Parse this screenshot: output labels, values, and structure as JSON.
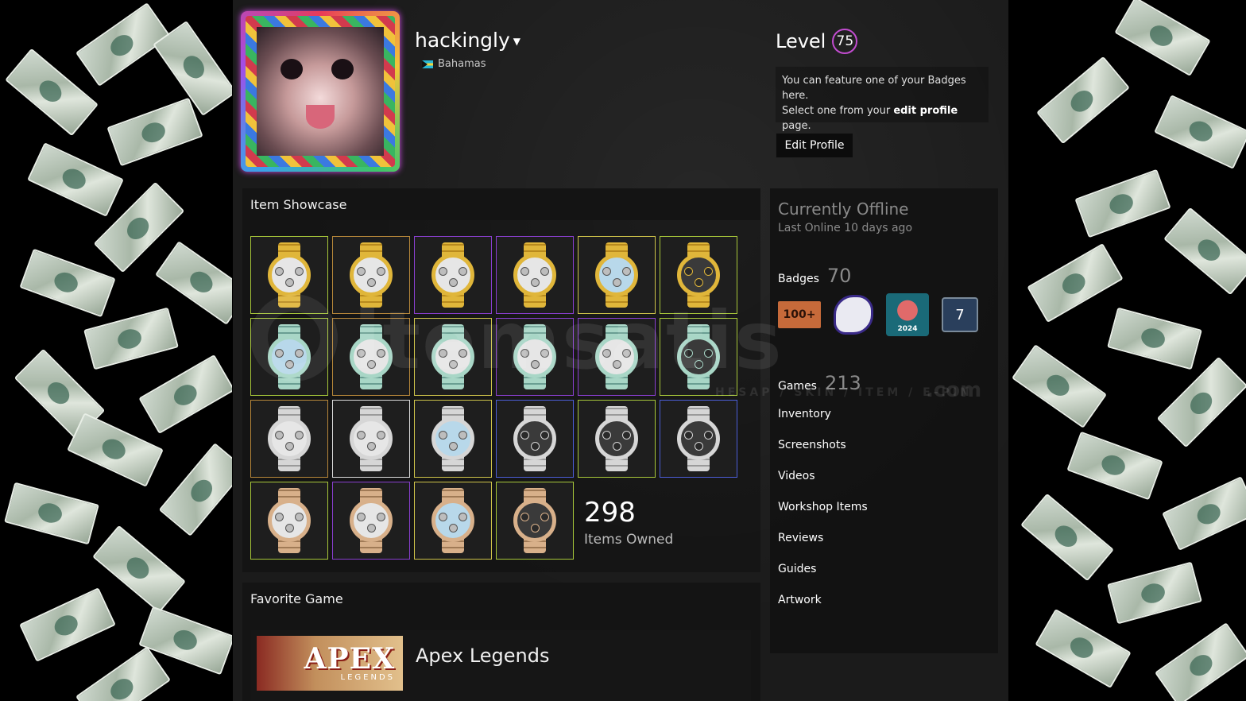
{
  "profile": {
    "persona_name": "hackingly",
    "country": "Bahamas",
    "level_label": "Level",
    "level_value": "75",
    "badge_note_line1": "You can feature one of your Badges here.",
    "badge_note_line2_pre": "Select one from your ",
    "badge_note_link": "edit profile",
    "badge_note_line2_post": " page.",
    "edit_profile_label": "Edit Profile"
  },
  "showcase": {
    "title": "Item Showcase",
    "items": [
      {
        "metal": "gold",
        "dial": "white",
        "quality": "q-lime"
      },
      {
        "metal": "gold",
        "dial": "white",
        "quality": "q-orange"
      },
      {
        "metal": "gold",
        "dial": "white",
        "quality": "q-purple"
      },
      {
        "metal": "gold",
        "dial": "white",
        "quality": "q-purple"
      },
      {
        "metal": "gold",
        "dial": "ice",
        "quality": "q-gold"
      },
      {
        "metal": "gold",
        "dial": "black",
        "quality": "q-lime"
      },
      {
        "metal": "green",
        "dial": "ice",
        "quality": "q-lime"
      },
      {
        "metal": "green",
        "dial": "white",
        "quality": "q-orange"
      },
      {
        "metal": "green",
        "dial": "white",
        "quality": "q-gold"
      },
      {
        "metal": "green",
        "dial": "white",
        "quality": "q-purple"
      },
      {
        "metal": "green",
        "dial": "white",
        "quality": "q-purple"
      },
      {
        "metal": "green",
        "dial": "black",
        "quality": "q-lime"
      },
      {
        "metal": "steel",
        "dial": "white",
        "quality": "q-orange"
      },
      {
        "metal": "steel",
        "dial": "white",
        "quality": "q-white"
      },
      {
        "metal": "steel",
        "dial": "ice",
        "quality": "q-gold"
      },
      {
        "metal": "steel",
        "dial": "black",
        "quality": "q-blue"
      },
      {
        "metal": "steel",
        "dial": "black",
        "quality": "q-lime"
      },
      {
        "metal": "steel",
        "dial": "black",
        "quality": "q-blue"
      },
      {
        "metal": "rose",
        "dial": "white",
        "quality": "q-lime"
      },
      {
        "metal": "rose",
        "dial": "white",
        "quality": "q-purple"
      },
      {
        "metal": "rose",
        "dial": "ice",
        "quality": "q-gold"
      },
      {
        "metal": "rose",
        "dial": "black",
        "quality": "q-lime"
      }
    ],
    "items_owned_count": "298",
    "items_owned_label": "Items Owned"
  },
  "favorite_game": {
    "title": "Favorite Game",
    "capsule_title": "APEX",
    "capsule_subtitle": "LEGENDS",
    "name": "Apex Legends"
  },
  "sidebar": {
    "status": "Currently Offline",
    "last_online": "Last Online 10 days ago",
    "badges_label": "Badges",
    "badges_count": "70",
    "badge_1_text": "100+",
    "badge_3_text": "2024",
    "badge_4_text": "7",
    "games_label": "Games",
    "games_count": "213",
    "links": [
      "Inventory",
      "Screenshots",
      "Videos",
      "Workshop Items",
      "Reviews",
      "Guides",
      "Artwork"
    ]
  },
  "watermark": {
    "text": "itemsatis",
    "sub": "HESAP / SKIN / ITEM / E-PIN",
    "com": ".com"
  },
  "colors": {
    "level_ring": "#c24cd0",
    "panel_bg": "#1b1b1b",
    "gold": "#d9b33a",
    "green": "#9ccfc0",
    "steel": "#cfcfcf",
    "rose": "#c9a07a"
  }
}
